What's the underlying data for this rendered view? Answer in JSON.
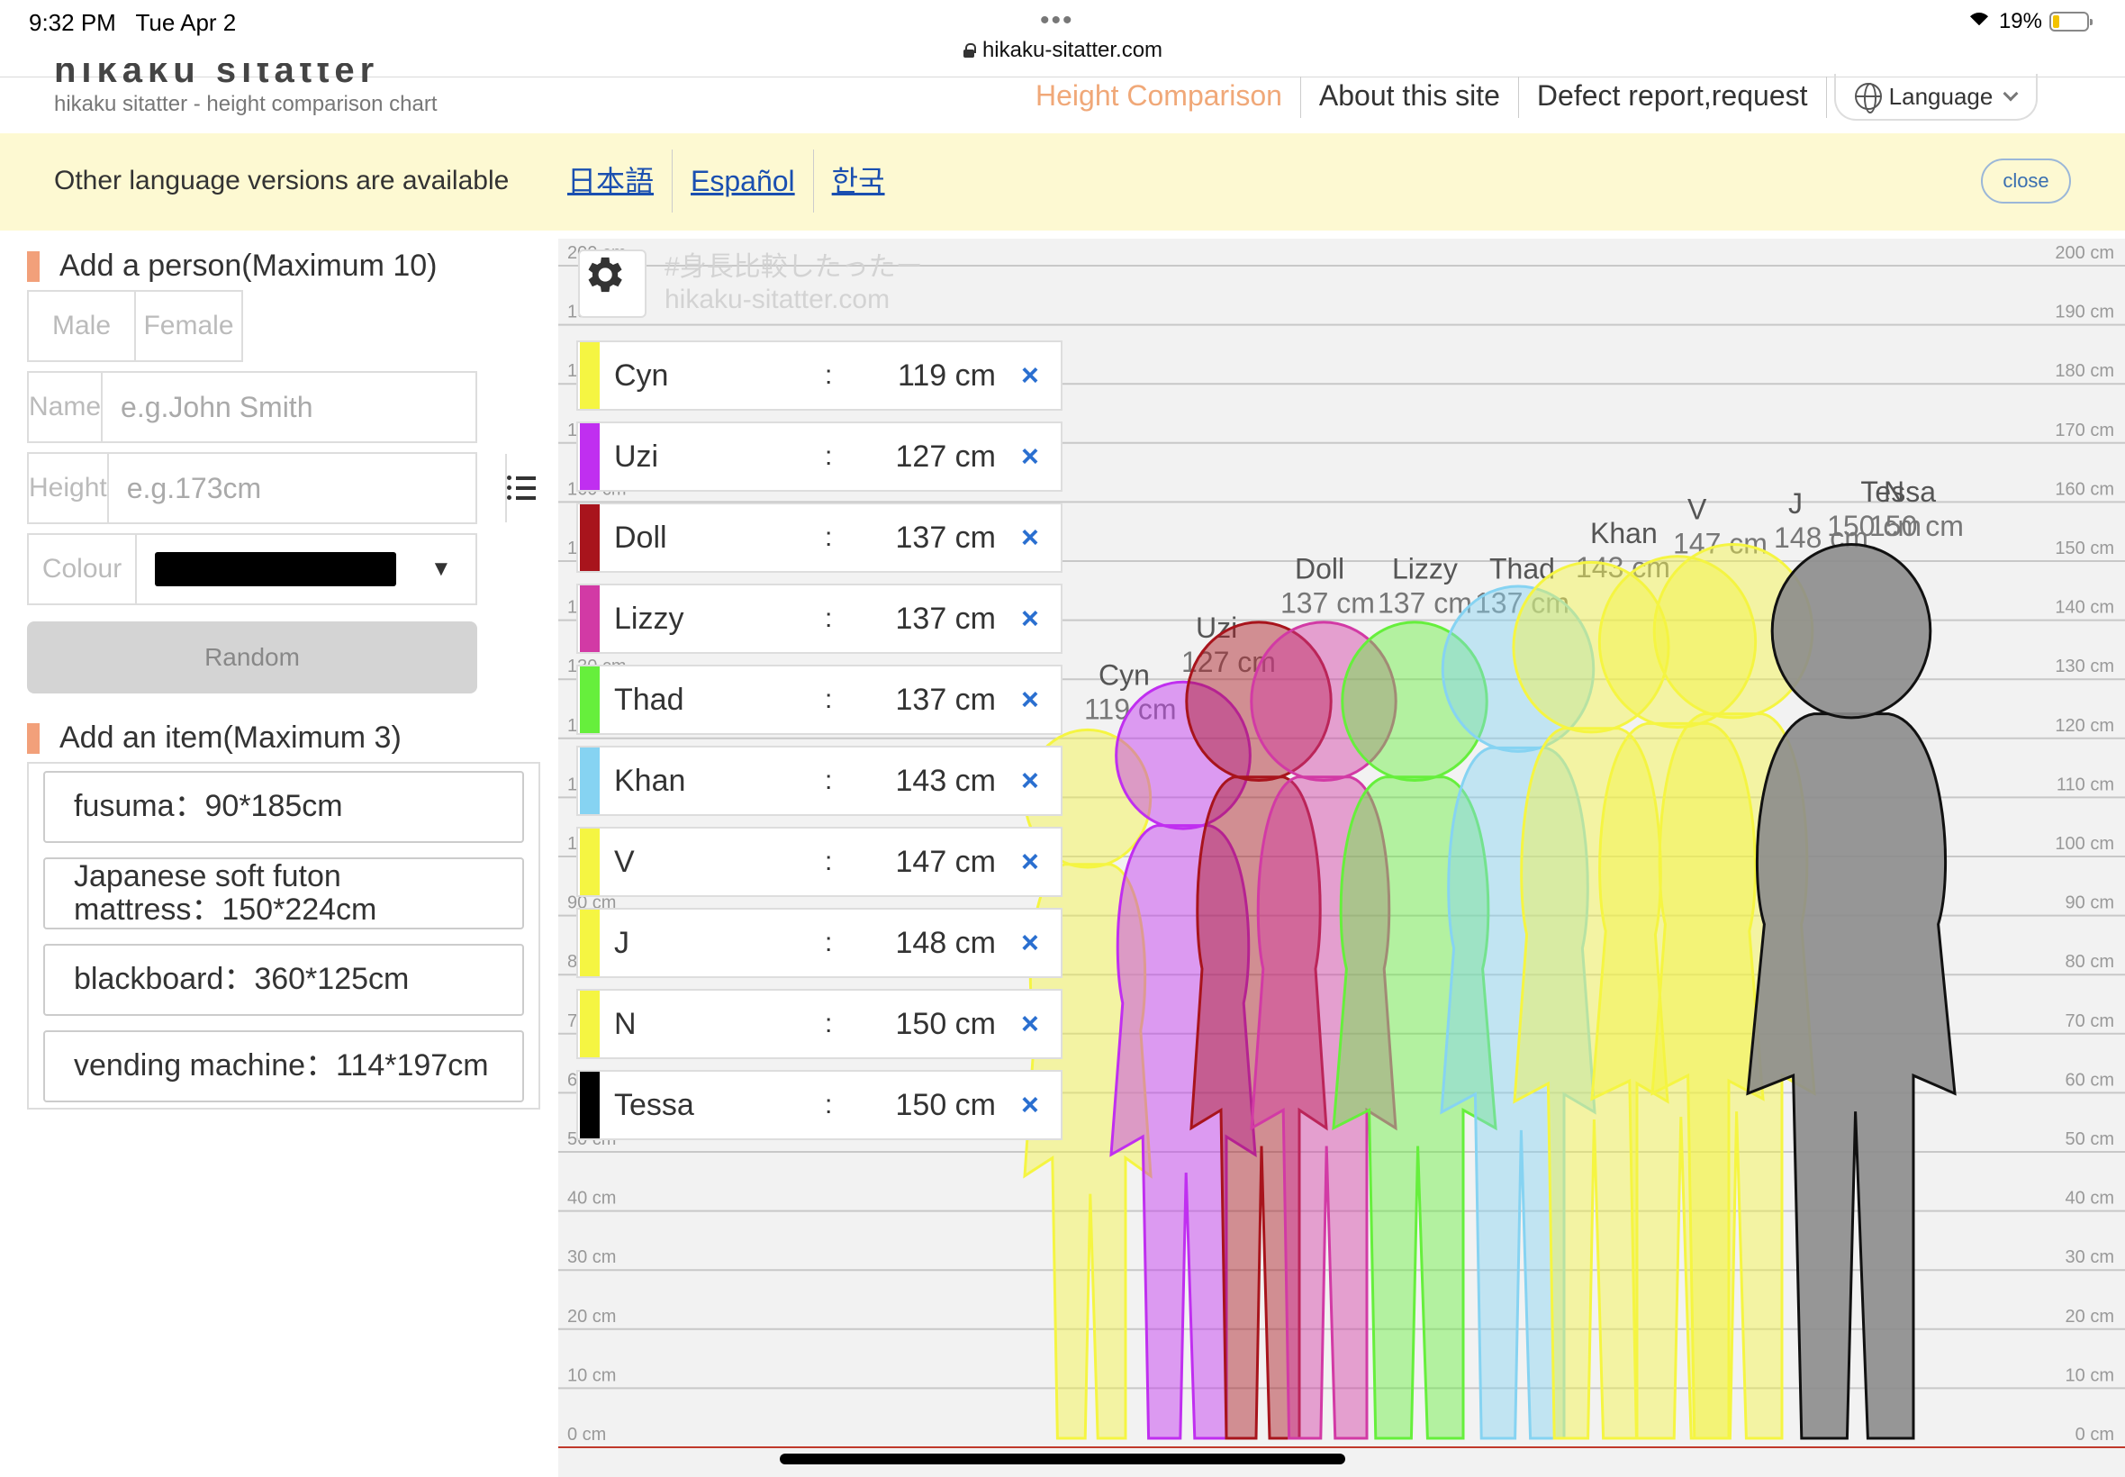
{
  "status_bar": {
    "time": "9:32 PM",
    "date": "Tue Apr 2",
    "battery": "19%",
    "url": "hikaku-sitatter.com"
  },
  "header": {
    "title": "hikaku sitatter",
    "subtitle": "hikaku sitatter - height comparison chart",
    "nav": [
      "Height Comparison",
      "About this site",
      "Defect report,request"
    ],
    "language_label": "Language"
  },
  "banner": {
    "text": "Other language versions are available",
    "links": [
      "日本語",
      "Español",
      "한국"
    ],
    "close_label": "close"
  },
  "add_person": {
    "title": "Add a person(Maximum 10)",
    "gender": [
      "Male",
      "Female"
    ],
    "name_label": "Name",
    "name_placeholder": "e.g.John Smith",
    "height_label": "Height",
    "height_placeholder": "e.g.173cm",
    "colour_label": "Colour",
    "colour_value": "#000000",
    "random_label": "Random"
  },
  "add_item": {
    "title": "Add an item(Maximum 3)",
    "items": [
      "fusuma：90*185cm",
      "Japanese soft futon mattress：150*224cm",
      "blackboard：360*125cm",
      "vending machine：114*197cm"
    ]
  },
  "chart_watermark": [
    "#身長比較したったー",
    "hikaku-sitatter.com"
  ],
  "chart_data": {
    "type": "bar",
    "unit": "cm",
    "ylim": [
      0,
      200
    ],
    "y_ticks": [
      "0 cm",
      "10 cm",
      "20 cm",
      "30 cm",
      "40 cm",
      "50 cm",
      "60 cm",
      "70 cm",
      "80 cm",
      "90 cm",
      "100 cm",
      "110 cm",
      "120 cm",
      "130 cm",
      "140 cm",
      "150 cm",
      "160 cm",
      "170 cm",
      "180 cm",
      "190 cm",
      "200 cm"
    ],
    "people": [
      {
        "name": "Cyn",
        "height": 119,
        "label": "119 cm",
        "color": "#f5f542"
      },
      {
        "name": "Uzi",
        "height": 127,
        "label": "127 cm",
        "color": "#c02ff0"
      },
      {
        "name": "Doll",
        "height": 137,
        "label": "137 cm",
        "color": "#a8141c"
      },
      {
        "name": "Lizzy",
        "height": 137,
        "label": "137 cm",
        "color": "#d23aa5"
      },
      {
        "name": "Thad",
        "height": 137,
        "label": "137 cm",
        "color": "#66ef3c"
      },
      {
        "name": "Khan",
        "height": 143,
        "label": "143 cm",
        "color": "#86d3f2"
      },
      {
        "name": "V",
        "height": 147,
        "label": "147 cm",
        "color": "#f5f542"
      },
      {
        "name": "J",
        "height": 148,
        "label": "148 cm",
        "color": "#f5f542"
      },
      {
        "name": "N",
        "height": 150,
        "label": "150 cm",
        "color": "#f5f542"
      },
      {
        "name": "Tessa",
        "height": 150,
        "label": "150 cm",
        "color": "#000000"
      }
    ]
  }
}
